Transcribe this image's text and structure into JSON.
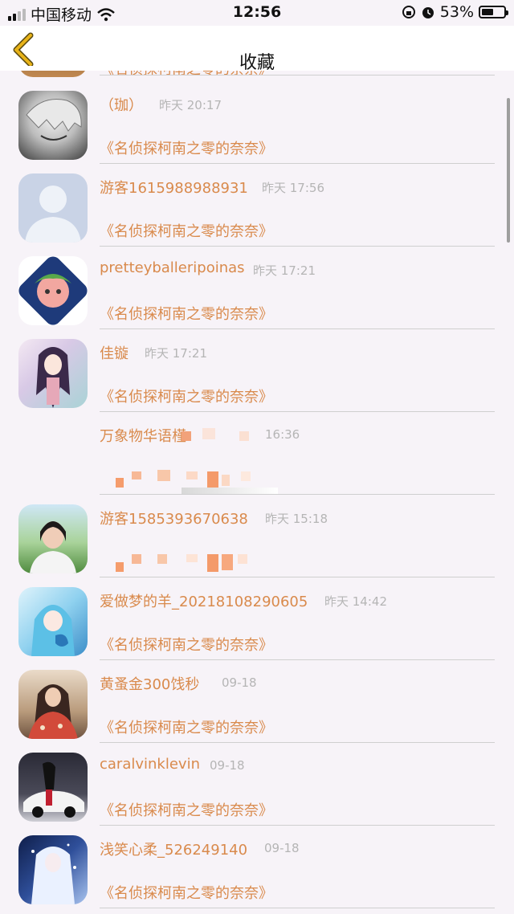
{
  "status_bar": {
    "carrier": "中国移动",
    "time": "12:56",
    "battery_percent": "53%",
    "battery_level": 0.53
  },
  "nav": {
    "title": "收藏",
    "back_icon": "chevron-left-icon"
  },
  "colors": {
    "accent": "#d98a4c",
    "back": "#e8b319",
    "background": "#f7f3f8"
  },
  "items": [
    {
      "name": "",
      "time": "",
      "content": "《名侦探柯南之零的奈奈》"
    },
    {
      "name": "（珈）",
      "time": "昨天 20:17",
      "content": "《名侦探柯南之零的奈奈》"
    },
    {
      "name": "游客1615988988931",
      "time": "昨天 17:56",
      "content": "《名侦探柯南之零的奈奈》"
    },
    {
      "name": "pretteyballeripoinas",
      "time": "昨天 17:21",
      "content": "《名侦探柯南之零的奈奈》"
    },
    {
      "name": "佳镟",
      "time": "昨天 17:21",
      "content": "《名侦探柯南之零的奈奈》"
    },
    {
      "name": "万象物华语槿",
      "time": "16:36",
      "content": ""
    },
    {
      "name": "游客1585393670638",
      "time": "昨天 15:18",
      "content": ""
    },
    {
      "name": "爱做梦的羊_20218108290605",
      "time": "昨天 14:42",
      "content": "《名侦探柯南之零的奈奈》"
    },
    {
      "name": "黄蚤金300饯秒",
      "time": "09-18",
      "content": "《名侦探柯南之零的奈奈》"
    },
    {
      "name": "caralvinklevin",
      "time": "09-18",
      "content": "《名侦探柯南之零的奈奈》"
    },
    {
      "name": "浅笑心柔_526249140",
      "time": "09-18",
      "content": "《名侦探柯南之零的奈奈》"
    }
  ]
}
